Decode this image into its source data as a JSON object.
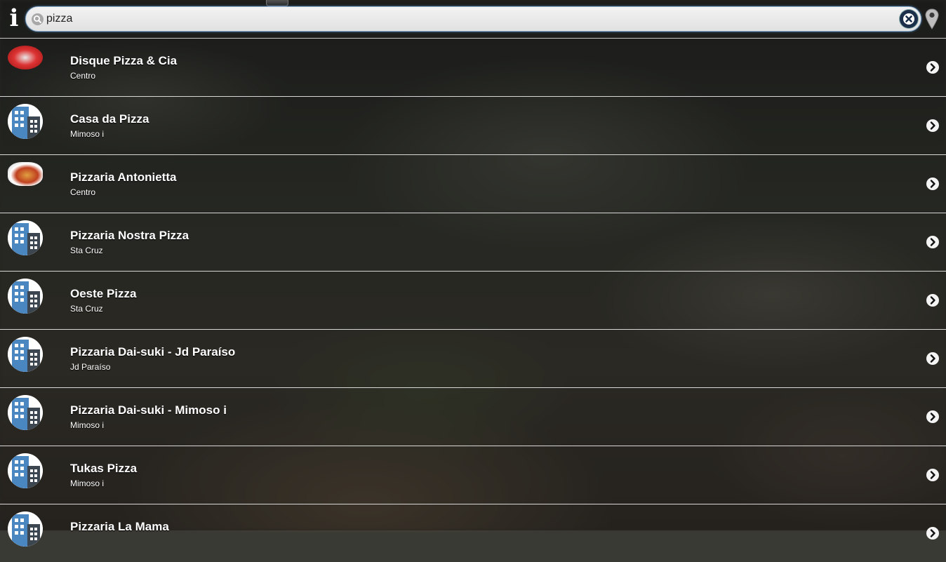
{
  "search": {
    "value": "pizza",
    "placeholder": ""
  },
  "icons": {
    "info": "info-icon",
    "search": "search-icon",
    "clear": "clear-icon",
    "location": "location-pin-icon",
    "chevron": "chevron-right-icon"
  },
  "colors": {
    "building_blue": "#4a86c0",
    "building_dark": "#3c4650",
    "clear_button": "#1c2f4a"
  },
  "results": [
    {
      "name": "Disque Pizza & Cia",
      "area": "Centro",
      "thumb": "logo-disque"
    },
    {
      "name": "Casa da Pizza",
      "area": "Mimoso i",
      "thumb": "building"
    },
    {
      "name": "Pizzaria Antonietta",
      "area": "Centro",
      "thumb": "logo-antonietta"
    },
    {
      "name": "Pizzaria Nostra Pizza",
      "area": "Sta Cruz",
      "thumb": "building"
    },
    {
      "name": "Oeste Pizza",
      "area": "Sta Cruz",
      "thumb": "building"
    },
    {
      "name": "Pizzaria Dai-suki - Jd Paraíso",
      "area": "Jd Paraíso",
      "thumb": "building"
    },
    {
      "name": "Pizzaria Dai-suki - Mimoso i",
      "area": "Mimoso i",
      "thumb": "building"
    },
    {
      "name": "Tukas Pizza",
      "area": "Mimoso i",
      "thumb": "building"
    },
    {
      "name": "Pizzaria La Mama",
      "area": "",
      "thumb": "building"
    }
  ]
}
